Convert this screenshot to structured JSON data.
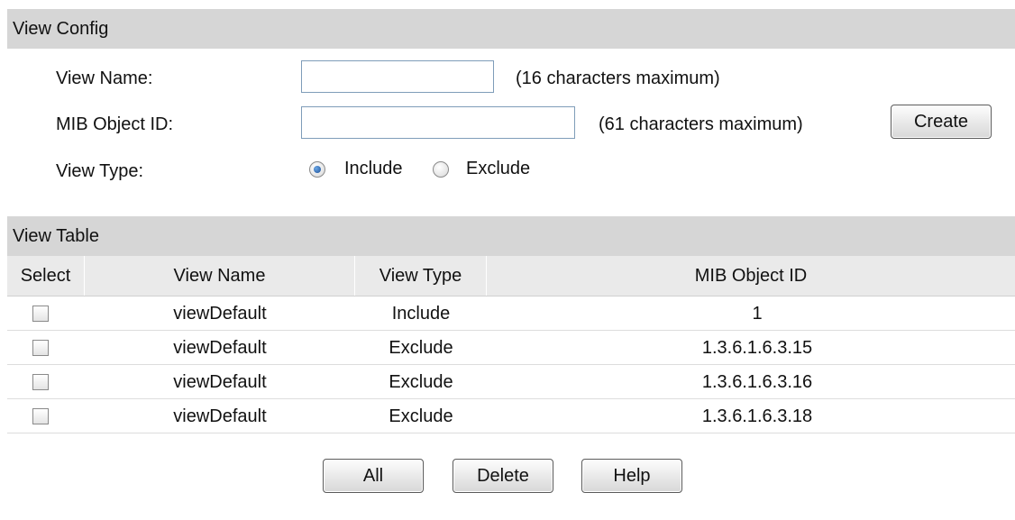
{
  "view_config": {
    "title": "View Config",
    "view_name": {
      "label": "View Name:",
      "value": "",
      "hint": "(16 characters maximum)"
    },
    "mib_object_id": {
      "label": "MIB Object ID:",
      "value": "",
      "hint": "(61 characters maximum)"
    },
    "create_label": "Create",
    "view_type": {
      "label": "View Type:",
      "options": [
        "Include",
        "Exclude"
      ],
      "selected": "Include"
    }
  },
  "view_table": {
    "title": "View Table",
    "columns": [
      "Select",
      "View Name",
      "View Type",
      "MIB Object ID"
    ],
    "rows": [
      {
        "selected": false,
        "view_name": "viewDefault",
        "view_type": "Include",
        "mib_object_id": "1"
      },
      {
        "selected": false,
        "view_name": "viewDefault",
        "view_type": "Exclude",
        "mib_object_id": "1.3.6.1.6.3.15"
      },
      {
        "selected": false,
        "view_name": "viewDefault",
        "view_type": "Exclude",
        "mib_object_id": "1.3.6.1.6.3.16"
      },
      {
        "selected": false,
        "view_name": "viewDefault",
        "view_type": "Exclude",
        "mib_object_id": "1.3.6.1.6.3.18"
      }
    ]
  },
  "actions": {
    "all_label": "All",
    "delete_label": "Delete",
    "help_label": "Help"
  }
}
